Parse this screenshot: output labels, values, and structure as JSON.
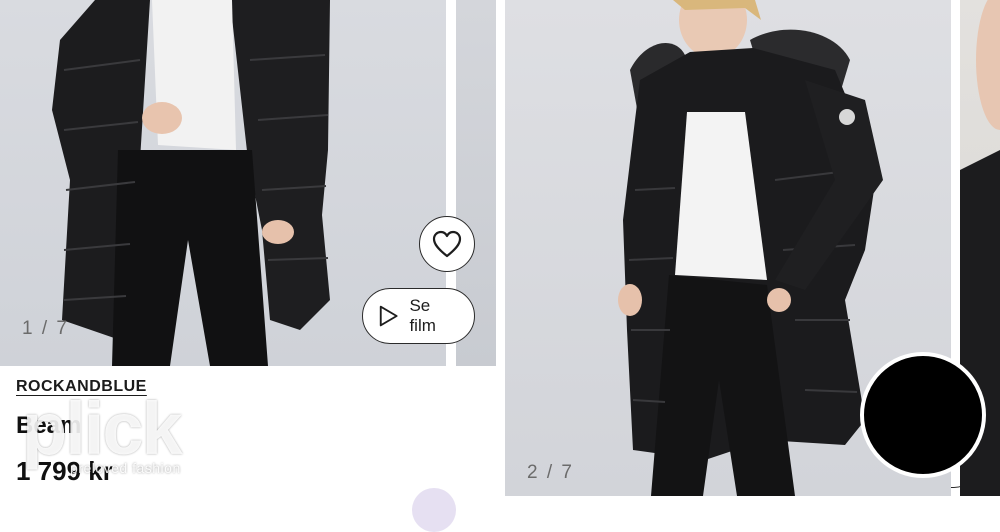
{
  "products": [
    {
      "image_counter": "1 / 7",
      "film_label": "Se film",
      "brand": "ROCKANDBLUE",
      "name": "Beam",
      "price": "1 799 kr"
    },
    {
      "image_counter": "2 / 7"
    }
  ],
  "watermark": {
    "main": "plick",
    "sub": "preloved fashion"
  },
  "icons": {
    "favorite": "heart-outline-icon",
    "play": "play-triangle-icon"
  }
}
